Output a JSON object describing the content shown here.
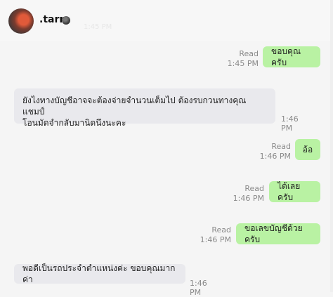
{
  "header": {
    "contact_name": ".tarn",
    "status_icon": "online-status-dot-icon",
    "faint_time": "1:45 PM"
  },
  "messages": [
    {
      "direction": "out",
      "text": "ขอบคุณครับ",
      "read": "Read",
      "time": "1:45 PM"
    },
    {
      "direction": "in",
      "text_line1": "ยังไงทางบัญชีอาจจะต้องจ่ายจำนวนเต็มไป ต้องรบกวนทางคุณแชมป์",
      "text_line2": "โอนมัดจำกลับมานิดนึงนะคะ",
      "time": "1:46 PM"
    },
    {
      "direction": "out",
      "text": "อ้อ",
      "read": "Read",
      "time": "1:46 PM"
    },
    {
      "direction": "out",
      "text": "ได้เลยครับ",
      "read": "Read",
      "time": "1:46 PM"
    },
    {
      "direction": "out",
      "text": "ขอเลขบัญชีด้วยครับ",
      "read": "Read",
      "time": "1:46 PM"
    },
    {
      "direction": "in",
      "text": "พอดีเป็นรถประจำตำแหน่งค่ะ ขอบคุณมากค่า",
      "time": "1:46 PM"
    }
  ],
  "colors": {
    "outgoing_bubble": "#b9f2a3",
    "incoming_bubble": "#e9e9ed",
    "background": "#f5f5f5"
  }
}
